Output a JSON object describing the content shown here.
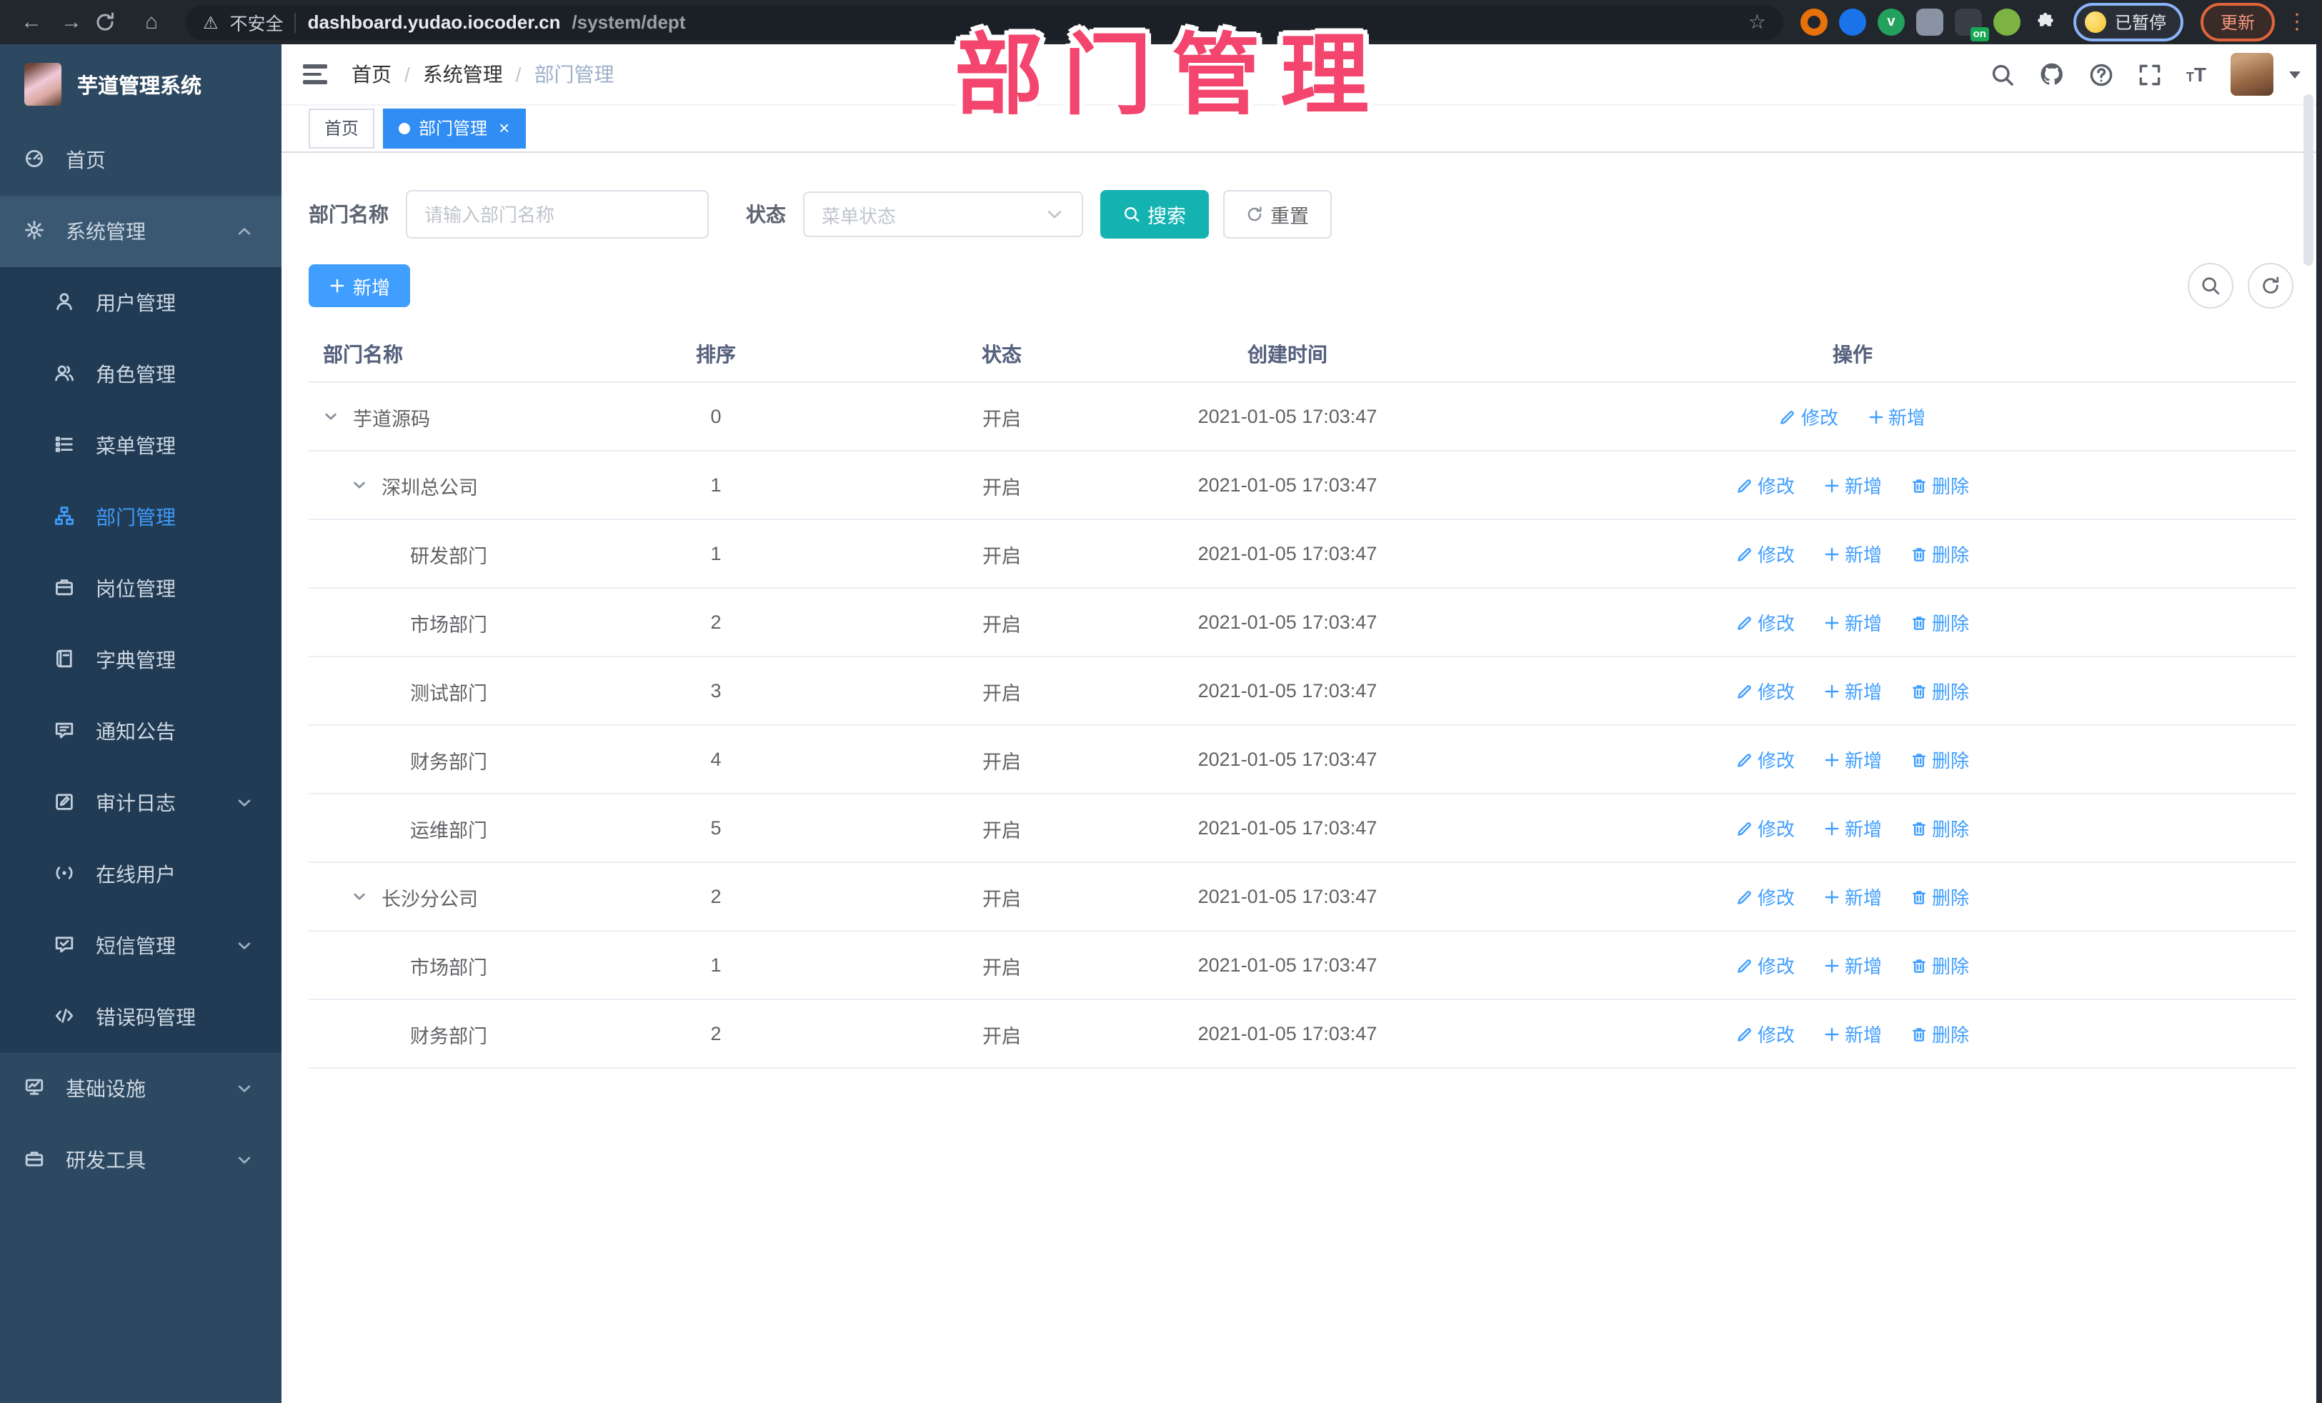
{
  "browser": {
    "security_label": "不安全",
    "url_host": "dashboard.yudao.iocoder.cn",
    "url_path": "/system/dept",
    "profile_label": "已暂停",
    "update_label": "更新",
    "extensions": [
      {
        "key": "ext-ring-orange",
        "color": "#e8710a",
        "style": "ring"
      },
      {
        "key": "ext-pin-blue",
        "color": "#1a73e8",
        "style": "dot"
      },
      {
        "key": "ext-v-green",
        "color": "#23a15d",
        "style": "letter",
        "letter": "v"
      },
      {
        "key": "ext-grid-gray",
        "color": "#8a93a3",
        "style": "square"
      },
      {
        "key": "ext-dark-on",
        "color": "#3a3f47",
        "style": "square",
        "badge": "on"
      },
      {
        "key": "ext-bot-green",
        "color": "#7cb342",
        "style": "dot"
      },
      {
        "key": "ext-puzzle",
        "color": "#e8eaed",
        "style": "puzzle"
      }
    ]
  },
  "sidebar": {
    "title": "芋道管理系统",
    "items": [
      {
        "key": "home",
        "label": "首页",
        "icon": "dashboard-icon",
        "type": "root"
      },
      {
        "key": "system",
        "label": "系统管理",
        "icon": "gear-icon",
        "type": "root",
        "chevron": "up",
        "highlight": true
      },
      {
        "key": "user",
        "label": "用户管理",
        "icon": "user-icon",
        "type": "sub"
      },
      {
        "key": "role",
        "label": "角色管理",
        "icon": "users-icon",
        "type": "sub"
      },
      {
        "key": "menu",
        "label": "菜单管理",
        "icon": "menu-list-icon",
        "type": "sub"
      },
      {
        "key": "dept",
        "label": "部门管理",
        "icon": "org-tree-icon",
        "type": "sub",
        "active": true
      },
      {
        "key": "post",
        "label": "岗位管理",
        "icon": "post-icon",
        "type": "sub"
      },
      {
        "key": "dict",
        "label": "字典管理",
        "icon": "dict-icon",
        "type": "sub"
      },
      {
        "key": "notice",
        "label": "通知公告",
        "icon": "notice-icon",
        "type": "sub"
      },
      {
        "key": "audit",
        "label": "审计日志",
        "icon": "audit-icon",
        "type": "sub",
        "chevron": "down"
      },
      {
        "key": "online",
        "label": "在线用户",
        "icon": "online-icon",
        "type": "sub"
      },
      {
        "key": "sms",
        "label": "短信管理",
        "icon": "sms-icon",
        "type": "sub",
        "chevron": "down"
      },
      {
        "key": "errcode",
        "label": "错误码管理",
        "icon": "code-icon",
        "type": "sub"
      },
      {
        "key": "infra",
        "label": "基础设施",
        "icon": "infra-icon",
        "type": "root",
        "chevron": "down"
      },
      {
        "key": "devtool",
        "label": "研发工具",
        "icon": "tools-icon",
        "type": "root",
        "chevron": "down"
      }
    ]
  },
  "topbar": {
    "breadcrumb": [
      "首页",
      "系统管理",
      "部门管理"
    ]
  },
  "tabs": [
    {
      "key": "home",
      "label": "首页"
    },
    {
      "key": "dept",
      "label": "部门管理",
      "active": true
    }
  ],
  "filters": {
    "dept_label": "部门名称",
    "dept_placeholder": "请输入部门名称",
    "status_label": "状态",
    "status_placeholder": "菜单状态",
    "search_label": "搜索",
    "reset_label": "重置"
  },
  "toolbar": {
    "add_label": "新增"
  },
  "table": {
    "headers": [
      "部门名称",
      "排序",
      "状态",
      "创建时间",
      "操作"
    ],
    "rows": [
      {
        "name": "芋道源码",
        "level": 0,
        "expandable": true,
        "sort": "0",
        "status": "开启",
        "created": "2021-01-05 17:03:47",
        "can_delete": false
      },
      {
        "name": "深圳总公司",
        "level": 1,
        "expandable": true,
        "sort": "1",
        "status": "开启",
        "created": "2021-01-05 17:03:47",
        "can_delete": true
      },
      {
        "name": "研发部门",
        "level": 2,
        "expandable": false,
        "sort": "1",
        "status": "开启",
        "created": "2021-01-05 17:03:47",
        "can_delete": true
      },
      {
        "name": "市场部门",
        "level": 2,
        "expandable": false,
        "sort": "2",
        "status": "开启",
        "created": "2021-01-05 17:03:47",
        "can_delete": true
      },
      {
        "name": "测试部门",
        "level": 2,
        "expandable": false,
        "sort": "3",
        "status": "开启",
        "created": "2021-01-05 17:03:47",
        "can_delete": true
      },
      {
        "name": "财务部门",
        "level": 2,
        "expandable": false,
        "sort": "4",
        "status": "开启",
        "created": "2021-01-05 17:03:47",
        "can_delete": true
      },
      {
        "name": "运维部门",
        "level": 2,
        "expandable": false,
        "sort": "5",
        "status": "开启",
        "created": "2021-01-05 17:03:47",
        "can_delete": true
      },
      {
        "name": "长沙分公司",
        "level": 1,
        "expandable": true,
        "sort": "2",
        "status": "开启",
        "created": "2021-01-05 17:03:47",
        "can_delete": true
      },
      {
        "name": "市场部门",
        "level": 2,
        "expandable": false,
        "sort": "1",
        "status": "开启",
        "created": "2021-01-05 17:03:47",
        "can_delete": true
      },
      {
        "name": "财务部门",
        "level": 2,
        "expandable": false,
        "sort": "2",
        "status": "开启",
        "created": "2021-01-05 17:03:47",
        "can_delete": true
      }
    ]
  },
  "row_actions": {
    "edit": "修改",
    "add": "新增",
    "delete": "删除"
  },
  "annotation": {
    "text": "部门管理",
    "color": "#f3456d"
  },
  "colors": {
    "accent_blue": "#409eff",
    "teal": "#14b3b1",
    "tab_active_blue": "#2f8df4",
    "sidebar_bg": "#2d4861",
    "sidebar_sub_bg": "#223b54",
    "link_blue": "#409eff",
    "annotation_pink": "#f3456d"
  }
}
